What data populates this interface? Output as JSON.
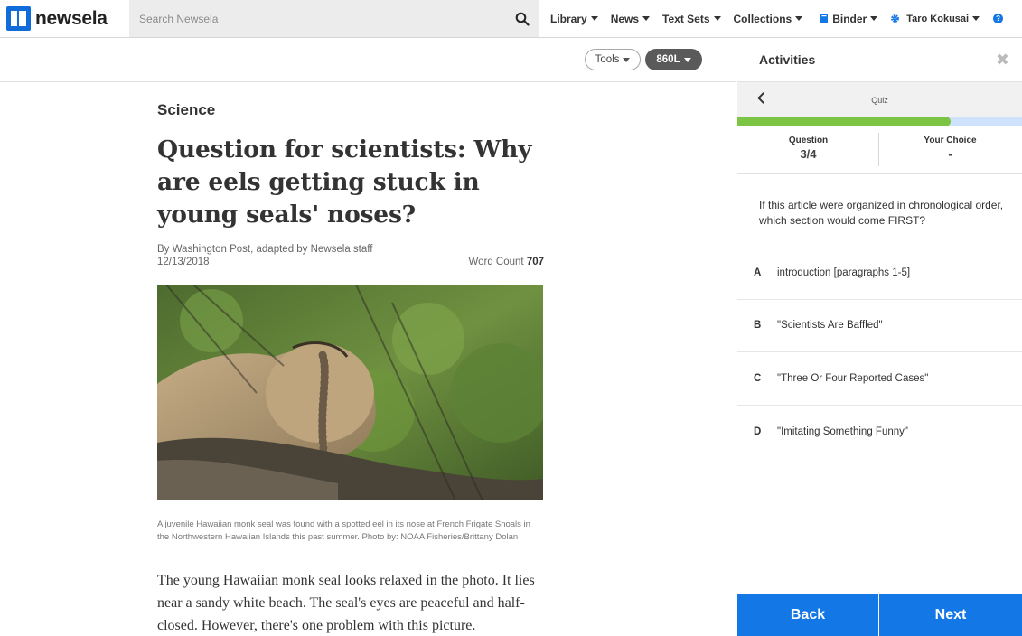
{
  "header": {
    "logo_text": "newsela",
    "search_placeholder": "Search Newsela",
    "nav": {
      "library": "Library",
      "news": "News",
      "text_sets": "Text Sets",
      "collections": "Collections",
      "binder": "Binder",
      "user": "Taro Kokusai",
      "help": "?"
    }
  },
  "article": {
    "tools_label": "Tools",
    "lexile_label": "860L",
    "subject": "Science",
    "headline": "Question for scientists: Why are eels getting stuck in young seals' noses?",
    "byline": "By Washington Post, adapted by Newsela staff",
    "date": "12/13/2018",
    "word_count_label": "Word Count",
    "word_count": "707",
    "caption": "A juvenile Hawaiian monk seal was found with a spotted eel in its nose at French Frigate Shoals in the Northwestern Hawaiian Islands this past summer. Photo by: NOAA Fisheries/Brittany Dolan",
    "body": "The young Hawaiian monk seal looks relaxed in the photo. It lies near a sandy white beach. The seal's eyes are peaceful and half-closed. However, there's one problem with this picture."
  },
  "activities": {
    "title": "Activities",
    "quiz_label": "Quiz",
    "progress": 0.75,
    "question_label": "Question",
    "question_value": "3/4",
    "choice_label": "Your Choice",
    "choice_value": "-",
    "question_text": "If this article were organized in chronological order, which section would come FIRST?",
    "answers": [
      {
        "letter": "A",
        "text": "introduction [paragraphs 1-5]"
      },
      {
        "letter": "B",
        "text": "\"Scientists Are Baffled\""
      },
      {
        "letter": "C",
        "text": "\"Three Or Four Reported Cases\""
      },
      {
        "letter": "D",
        "text": "\"Imitating Something Funny\""
      }
    ],
    "back_label": "Back",
    "next_label": "Next"
  },
  "colors": {
    "brand_blue": "#1477e6",
    "progress_green": "#7cc443",
    "progress_track": "#cfe2fb"
  }
}
